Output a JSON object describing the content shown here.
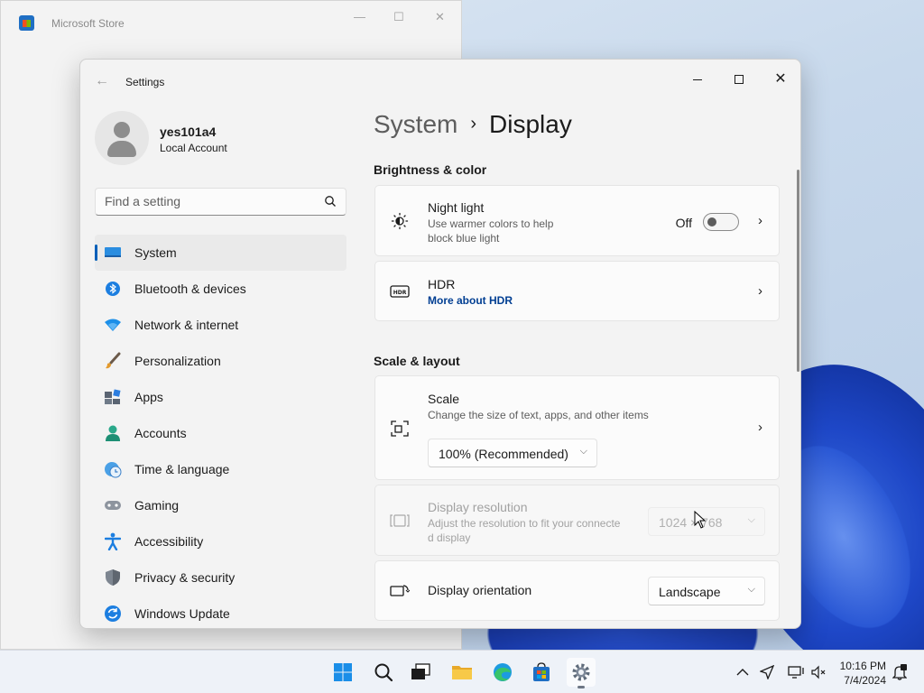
{
  "store_window": {
    "title": "Microsoft Store"
  },
  "settings": {
    "title": "Settings",
    "user": {
      "name": "yes101a4",
      "account_type": "Local Account"
    },
    "search": {
      "placeholder": "Find a setting"
    },
    "nav": [
      {
        "label": "System",
        "icon": "system-icon",
        "active": true
      },
      {
        "label": "Bluetooth & devices",
        "icon": "bluetooth-icon"
      },
      {
        "label": "Network & internet",
        "icon": "wifi-icon"
      },
      {
        "label": "Personalization",
        "icon": "brush-icon"
      },
      {
        "label": "Apps",
        "icon": "apps-icon"
      },
      {
        "label": "Accounts",
        "icon": "person-icon"
      },
      {
        "label": "Time & language",
        "icon": "clock-globe-icon"
      },
      {
        "label": "Gaming",
        "icon": "gamepad-icon"
      },
      {
        "label": "Accessibility",
        "icon": "accessibility-icon"
      },
      {
        "label": "Privacy & security",
        "icon": "shield-icon"
      },
      {
        "label": "Windows Update",
        "icon": "update-icon"
      }
    ],
    "breadcrumb": {
      "parent": "System",
      "separator": "›",
      "current": "Display"
    },
    "sections": {
      "brightness": "Brightness & color",
      "scale_layout": "Scale & layout"
    },
    "night_light": {
      "title": "Night light",
      "subtitle_line1": "Use warmer colors to help",
      "subtitle_line2": "block blue light",
      "state_label": "Off",
      "on": false
    },
    "hdr": {
      "title": "HDR",
      "link": "More about HDR"
    },
    "scale": {
      "title": "Scale",
      "subtitle": "Change the size of text, apps, and other items",
      "value": "100% (Recommended)"
    },
    "resolution": {
      "title": "Display resolution",
      "subtitle_line1": "Adjust the resolution to fit your connecte",
      "subtitle_line2": "d display",
      "value": "1024 × 768",
      "disabled": true
    },
    "orientation": {
      "title": "Display orientation",
      "value": "Landscape"
    }
  },
  "taskbar": {
    "time": "10:16 PM",
    "date": "7/4/2024",
    "apps": [
      "start-icon",
      "search-icon",
      "task-view-icon",
      "file-explorer-icon",
      "edge-icon",
      "store-icon",
      "settings-icon"
    ]
  },
  "colors": {
    "accent": "#005fb8",
    "link": "#003e92"
  }
}
